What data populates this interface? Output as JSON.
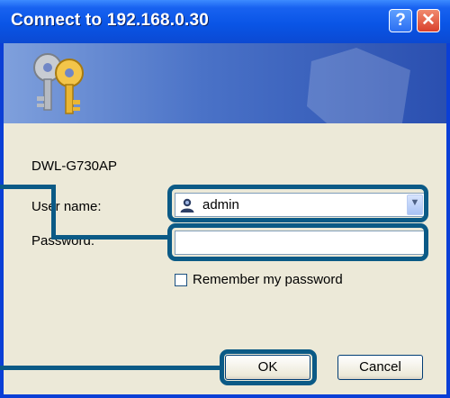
{
  "window": {
    "title": "Connect to 192.168.0.30",
    "help_glyph": "?",
    "close_glyph": "✕"
  },
  "dialog": {
    "model": "DWL-G730AP",
    "username_label": "User name:",
    "username_value": "admin",
    "password_label": "Password:",
    "password_value": "",
    "remember_label": "Remember my password",
    "remember_checked": false,
    "ok_label": "OK",
    "cancel_label": "Cancel"
  },
  "icons": {
    "banner": "keys-icon",
    "user": "user-icon",
    "dropdown": "chevron-down-icon"
  },
  "colors": {
    "title_bar": "#0a55e6",
    "dialog_bg": "#ece9d8",
    "callout": "#0b5a86"
  }
}
